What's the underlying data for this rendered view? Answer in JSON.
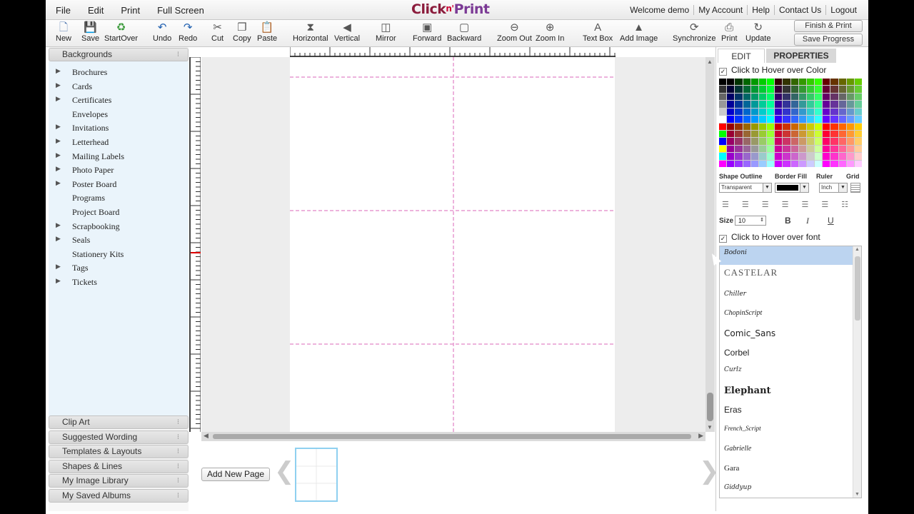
{
  "menubar": {
    "left": [
      "File",
      "Edit",
      "Print",
      "Full Screen"
    ],
    "logo": {
      "part1": "Click",
      "mid": "n'",
      "part2": "Print"
    },
    "right": [
      "Welcome demo",
      "My Account",
      "Help",
      "Contact Us",
      "Logout"
    ]
  },
  "toolbar": {
    "tools": [
      {
        "label": "New",
        "icon": "new-page-icon",
        "glyph": "🗋"
      },
      {
        "label": "Save",
        "icon": "floppy-icon",
        "glyph": "💾"
      },
      {
        "label": "StartOver",
        "icon": "recycle-icon",
        "glyph": "♻"
      },
      {
        "label": "Undo",
        "icon": "undo-icon",
        "glyph": "↶"
      },
      {
        "label": "Redo",
        "icon": "redo-icon",
        "glyph": "↷"
      },
      {
        "label": "Cut",
        "icon": "scissors-icon",
        "glyph": "✂"
      },
      {
        "label": "Copy",
        "icon": "copy-icon",
        "glyph": "❐"
      },
      {
        "label": "Paste",
        "icon": "paste-icon",
        "glyph": "📋"
      },
      {
        "label": "Horizontal",
        "icon": "flip-horizontal-icon",
        "glyph": "⧗"
      },
      {
        "label": "Vertical",
        "icon": "flip-vertical-icon",
        "glyph": "◀"
      },
      {
        "label": "Mirror",
        "icon": "mirror-icon",
        "glyph": "◫"
      },
      {
        "label": "Forward",
        "icon": "bring-forward-icon",
        "glyph": "▣"
      },
      {
        "label": "Backward",
        "icon": "send-backward-icon",
        "glyph": "▢"
      },
      {
        "label": "Zoom Out",
        "icon": "zoom-out-icon",
        "glyph": "⊖"
      },
      {
        "label": "Zoom In",
        "icon": "zoom-in-icon",
        "glyph": "⊕"
      },
      {
        "label": "Text Box",
        "icon": "text-box-icon",
        "glyph": "A"
      },
      {
        "label": "Add Image",
        "icon": "add-image-icon",
        "glyph": "▲"
      },
      {
        "label": "Synchronize",
        "icon": "sync-icon",
        "glyph": "⟳"
      },
      {
        "label": "Print",
        "icon": "printer-icon",
        "glyph": "⎙"
      },
      {
        "label": "Update",
        "icon": "refresh-icon",
        "glyph": "↻"
      }
    ],
    "finish_print": "Finish & Print",
    "save_progress": "Save Progress"
  },
  "leftpanel": {
    "header": "Backgrounds",
    "categories": [
      {
        "label": "Brochures",
        "expandable": true
      },
      {
        "label": "Cards",
        "expandable": true
      },
      {
        "label": "Certificates",
        "expandable": true
      },
      {
        "label": "Envelopes",
        "expandable": false
      },
      {
        "label": "Invitations",
        "expandable": true
      },
      {
        "label": "Letterhead",
        "expandable": true
      },
      {
        "label": "Mailing Labels",
        "expandable": true
      },
      {
        "label": "Photo Paper",
        "expandable": true
      },
      {
        "label": "Poster Board",
        "expandable": true
      },
      {
        "label": "Programs",
        "expandable": false
      },
      {
        "label": "Project Board",
        "expandable": false
      },
      {
        "label": "Scrapbooking",
        "expandable": true
      },
      {
        "label": "Seals",
        "expandable": true
      },
      {
        "label": "Stationery Kits",
        "expandable": false
      },
      {
        "label": "Tags",
        "expandable": true
      },
      {
        "label": "Tickets",
        "expandable": true
      }
    ],
    "sections": [
      "Clip Art",
      "Suggested Wording",
      "Templates & Layouts",
      "Shapes & Lines",
      "My Image Library",
      "My Saved Albums"
    ]
  },
  "bottom": {
    "add_page": "Add New Page"
  },
  "rightpanel": {
    "tabs": [
      "EDIT",
      "PROPERTIES"
    ],
    "hover_color": "Click to Hover over Color",
    "labels": {
      "shape_outline": "Shape Outline",
      "border_fill": "Border Fill",
      "ruler": "Ruler",
      "grid": "Grid"
    },
    "shape_outline_value": "Transparent",
    "ruler_value": "Inch",
    "size_label": "Size",
    "size_value": "10",
    "bold": "B",
    "italic": "I",
    "underline": "U",
    "hover_font": "Click to Hover over font",
    "fonts": [
      {
        "name": "Bodoni",
        "family": "\"DejaVu Serif\", serif",
        "size": 9
      },
      {
        "name": "CASTELAR",
        "family": "\"Liberation Serif\", serif",
        "size": 13
      },
      {
        "name": "Chiller",
        "family": "\"DejaVu Serif\", serif",
        "size": 9
      },
      {
        "name": "ChopinScript",
        "family": "\"Liberation Serif\", serif",
        "size": 10
      },
      {
        "name": "Comic_Sans",
        "family": "\"DejaVu Sans\", sans-serif",
        "size": 12
      },
      {
        "name": "Corbel",
        "family": "\"Liberation Sans\", sans-serif",
        "size": 12
      },
      {
        "name": "Curlz",
        "family": "\"DejaVu Serif\", serif",
        "size": 9
      },
      {
        "name": "Elephant",
        "family": "\"DejaVu Serif\", serif",
        "size": 13
      },
      {
        "name": "Eras",
        "family": "\"Liberation Sans\", sans-serif",
        "size": 12
      },
      {
        "name": "French_Script",
        "family": "\"Liberation Serif\", serif",
        "size": 9
      },
      {
        "name": "Gabrielle",
        "family": "\"Liberation Serif\", serif",
        "size": 10
      },
      {
        "name": "Gara",
        "family": "\"Liberation Serif\", serif",
        "size": 11
      },
      {
        "name": "Giddyup",
        "family": "\"DejaVu Serif\", serif",
        "size": 9
      }
    ]
  }
}
